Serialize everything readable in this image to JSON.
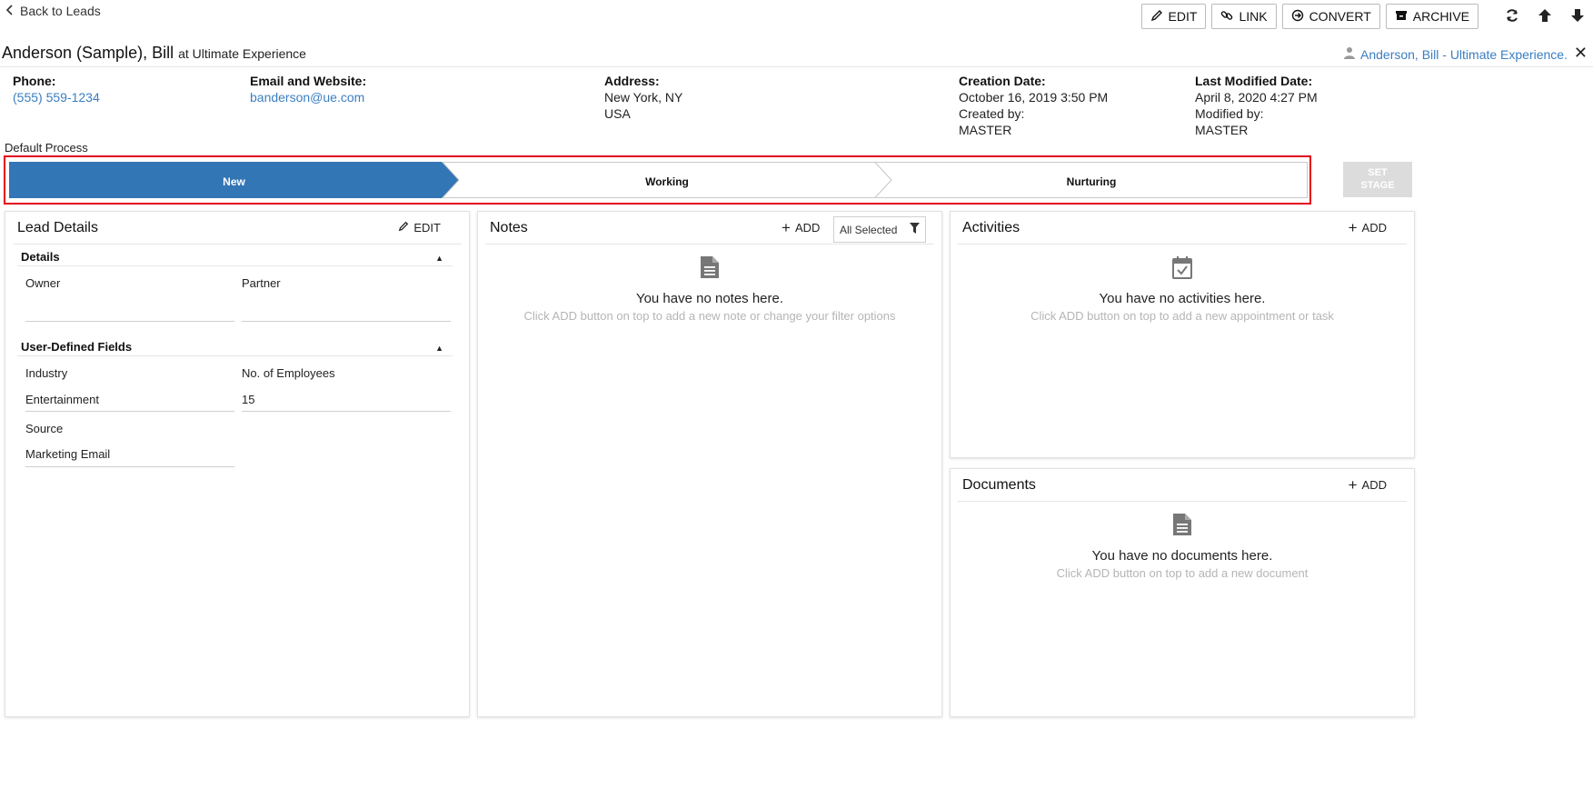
{
  "nav": {
    "back_label": "Back to Leads"
  },
  "toolbar": {
    "edit": "EDIT",
    "link": "LINK",
    "convert": "CONVERT",
    "archive": "ARCHIVE",
    "icons": [
      "refresh-icon",
      "arrow-up-icon",
      "arrow-down-icon"
    ]
  },
  "lead": {
    "name": "Anderson (Sample), Bill",
    "at_company": "at Ultimate Experience",
    "owner_link": "Anderson, Bill - Ultimate Experience."
  },
  "info": {
    "phone_label": "Phone:",
    "phone": "(555) 559-1234",
    "email_label": "Email and Website:",
    "email": "banderson@ue.com",
    "address_label": "Address:",
    "address_line1": "New York, NY",
    "address_line2": "USA",
    "creation_label": "Creation Date:",
    "creation_date": "October 16, 2019 3:50 PM",
    "created_by_label": "Created by:",
    "created_by": "MASTER",
    "modified_label": "Last Modified Date:",
    "modified_date": "April 8, 2020 4:27 PM",
    "modified_by_label": "Modified by:",
    "modified_by": "MASTER"
  },
  "process": {
    "label": "Default Process",
    "stages": [
      "New",
      "Working",
      "Nurturing"
    ],
    "active_stage": "New",
    "set_stage_line1": "SET",
    "set_stage_line2": "STAGE",
    "active_color": "#3376b5"
  },
  "lead_details": {
    "title": "Lead Details",
    "edit": "EDIT",
    "details_section": "Details",
    "owner_label": "Owner",
    "owner_value": "",
    "partner_label": "Partner",
    "partner_value": "",
    "udf_section": "User-Defined Fields",
    "industry_label": "Industry",
    "industry_value": "Entertainment",
    "employees_label": "No. of Employees",
    "employees_value": "15",
    "source_label": "Source",
    "source_value": "Marketing Email"
  },
  "notes": {
    "title": "Notes",
    "add": "ADD",
    "filter": "All Selected",
    "empty_msg": "You have no notes here.",
    "empty_sub": "Click ADD button on top to add a new note or change your filter options"
  },
  "activities": {
    "title": "Activities",
    "add": "ADD",
    "empty_msg": "You have no activities here.",
    "empty_sub": "Click ADD button on top to add a new appointment or task"
  },
  "documents": {
    "title": "Documents",
    "add": "ADD",
    "empty_msg": "You have no documents here.",
    "empty_sub": "Click ADD button on top to add a new document"
  }
}
